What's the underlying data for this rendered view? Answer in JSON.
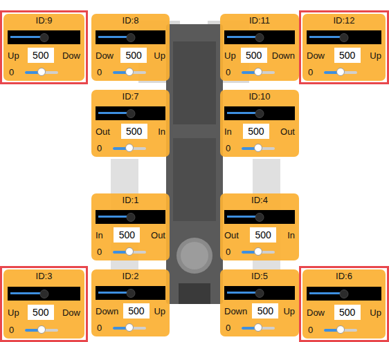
{
  "panels": [
    {
      "id": "ID:9",
      "highlighted": true,
      "position_level": 0.5,
      "left_label": "Up",
      "value": "500",
      "right_label": "Dow",
      "offset": "0",
      "offset_level": 0.5
    },
    {
      "id": "ID:8",
      "highlighted": false,
      "position_level": 0.5,
      "left_label": "Dow",
      "value": "500",
      "right_label": "Up",
      "offset": "0",
      "offset_level": 0.5
    },
    {
      "id": "ID:11",
      "highlighted": false,
      "position_level": 0.5,
      "left_label": "Up",
      "value": "500",
      "right_label": "Down",
      "offset": "0",
      "offset_level": 0.5
    },
    {
      "id": "ID:12",
      "highlighted": true,
      "position_level": 0.5,
      "left_label": "Dow",
      "value": "500",
      "right_label": "Up",
      "offset": "0",
      "offset_level": 0.5
    },
    {
      "id": "ID:7",
      "highlighted": false,
      "position_level": 0.5,
      "left_label": "Out",
      "value": "500",
      "right_label": "In",
      "offset": "0",
      "offset_level": 0.5
    },
    {
      "id": "ID:10",
      "highlighted": false,
      "position_level": 0.5,
      "left_label": "In",
      "value": "500",
      "right_label": "Out",
      "offset": "0",
      "offset_level": 0.5
    },
    {
      "id": "ID:1",
      "highlighted": false,
      "position_level": 0.5,
      "left_label": "In",
      "value": "500",
      "right_label": "Out",
      "offset": "0",
      "offset_level": 0.5
    },
    {
      "id": "ID:4",
      "highlighted": false,
      "position_level": 0.5,
      "left_label": "Out",
      "value": "500",
      "right_label": "In",
      "offset": "0",
      "offset_level": 0.5
    },
    {
      "id": "ID:3",
      "highlighted": true,
      "position_level": 0.5,
      "left_label": "Up",
      "value": "500",
      "right_label": "Dow",
      "offset": "0",
      "offset_level": 0.5
    },
    {
      "id": "ID:2",
      "highlighted": false,
      "position_level": 0.5,
      "left_label": "Down",
      "value": "500",
      "right_label": "Up",
      "offset": "0",
      "offset_level": 0.5
    },
    {
      "id": "ID:5",
      "highlighted": false,
      "position_level": 0.5,
      "left_label": "Down",
      "value": "500",
      "right_label": "Up",
      "offset": "0",
      "offset_level": 0.5
    },
    {
      "id": "ID:6",
      "highlighted": true,
      "position_level": 0.5,
      "left_label": "Dow",
      "value": "500",
      "right_label": "Up",
      "offset": "0",
      "offset_level": 0.5
    }
  ]
}
